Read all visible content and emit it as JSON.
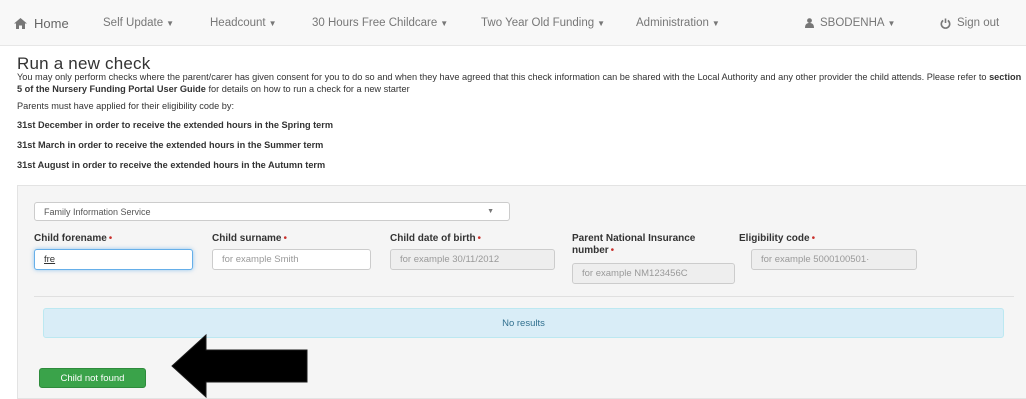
{
  "nav": {
    "home": "Home",
    "self_update": "Self Update",
    "headcount": "Headcount",
    "thirty_hours": "30 Hours Free Childcare",
    "two_year": "Two Year Old Funding",
    "administration": "Administration",
    "user": "SBODENHA",
    "sign_out": "Sign out"
  },
  "page": {
    "title": "Run a new check",
    "intro_1": "You may only perform checks where the parent/carer has given consent for you to do so and when they have agreed that this check information can be shared with the Local Authority and any other provider the child attends. Please refer to ",
    "intro_bold": "section 5 of the Nursery Funding Portal User Guide",
    "intro_2": " for details on how to run a check for a new starter",
    "applied_by": "Parents must have applied for their eligibility code by:",
    "deadline_spring": "31st December in order to receive the extended hours in the Spring term",
    "deadline_summer": "31st March in order to receive the extended hours in the Summer term",
    "deadline_autumn": "31st August in order to receive the extended hours in the Autumn term"
  },
  "form": {
    "provider_select": "Family Information Service",
    "required_marker": "•",
    "child_forename": {
      "label": "Child forename",
      "value": "fre"
    },
    "child_surname": {
      "label": "Child surname",
      "placeholder": "for example Smith"
    },
    "child_dob": {
      "label": "Child date of birth",
      "placeholder": "for example 30/11/2012"
    },
    "parent_ni": {
      "label_1": "Parent National Insurance",
      "label_2": "number",
      "placeholder": "for example NM123456C"
    },
    "eligibility": {
      "label": "Eligibility code",
      "placeholder": "for example 5000100501·"
    }
  },
  "results": {
    "message": "No results"
  },
  "actions": {
    "child_not_found": "Child not found"
  },
  "colors": {
    "navbar_bg": "#f8f8f8",
    "alert_bg": "#d9edf7",
    "success": "#3aa34a",
    "required": "#c9302c"
  }
}
